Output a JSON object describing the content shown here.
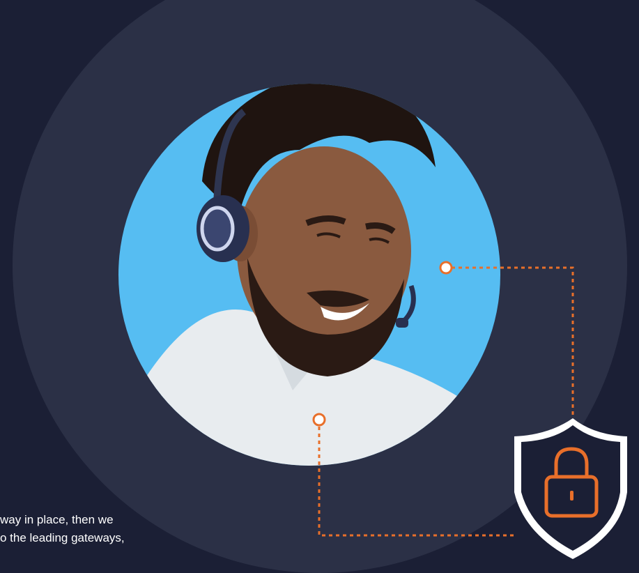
{
  "text": {
    "line1": "way in place, then we",
    "line2": "o the leading gateways,"
  },
  "colors": {
    "background": "#1b1f35",
    "circle": "#2b3046",
    "photo_bg": "#56bdf2",
    "accent": "#e86f2a",
    "shield": "#ffffff"
  },
  "icons": {
    "shield": "shield-icon",
    "lock": "lock-icon"
  }
}
